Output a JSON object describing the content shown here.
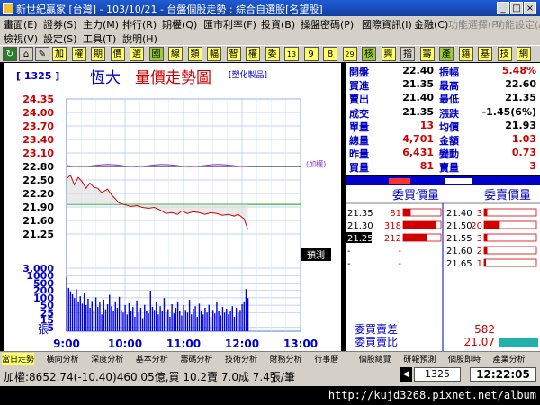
{
  "window": {
    "title": "新世紀贏家 [台灣] - 103/10/21 - 台盤個股走勢 : 綜合自選股[名望股]",
    "controls": [
      "_",
      "□",
      "×"
    ]
  },
  "menu1": [
    {
      "label": "畫面(E)",
      "enabled": true
    },
    {
      "label": "證券(S)",
      "enabled": true
    },
    {
      "label": "主力(M)",
      "enabled": true
    },
    {
      "label": "排行(R)",
      "enabled": true
    },
    {
      "label": "期權(Q)",
      "enabled": true
    },
    {
      "label": "匯市利率(F)",
      "enabled": true
    },
    {
      "label": "投資(B)",
      "enabled": true
    },
    {
      "label": "操盤密碼(P)",
      "enabled": true
    },
    {
      "label": "國際資訊(I)",
      "enabled": true
    },
    {
      "label": "金融(C)",
      "enabled": true
    },
    {
      "label": "功能選擇(P)",
      "enabled": false
    },
    {
      "label": "功能設定(A)",
      "enabled": false
    }
  ],
  "menu2": [
    {
      "label": "檢視(V)",
      "enabled": true
    },
    {
      "label": "設定(S)",
      "enabled": true
    },
    {
      "label": "工具(T)",
      "enabled": true
    },
    {
      "label": "說明(H)",
      "enabled": true
    }
  ],
  "toolbar": [
    "加",
    "權",
    "期",
    "價",
    "選",
    "國",
    "線",
    "類",
    "幅",
    "智",
    "權",
    "委",
    "13",
    "9",
    "8",
    "29",
    "核",
    "興",
    "指",
    "籌",
    "產",
    "籍",
    "基",
    "技",
    "網"
  ],
  "chart": {
    "code": "[ 1325 ]",
    "name": "恆大",
    "heading": "量價走勢圖",
    "industry": "[塑化製品]",
    "ref_label": "(加權)",
    "panel_label": "預測",
    "vol_unit": "張",
    "price_ticks": [
      "24.35",
      "24.00",
      "23.70",
      "23.40",
      "23.10",
      "22.80",
      "22.50",
      "22.20",
      "21.90",
      "21.60",
      "21.25"
    ],
    "vol_ticks": [
      "3,000",
      "1000",
      "500",
      "200",
      "100",
      "50",
      "25",
      "15",
      "5"
    ],
    "time_ticks": [
      "9:00",
      "10:00",
      "11:00",
      "12:00",
      "13:00"
    ]
  },
  "quote": {
    "rows": [
      {
        "l1": "開盤",
        "v1": "22.40",
        "c1": "#000000",
        "l2": "振幅",
        "v2": "5.48%",
        "c2": "#d00000"
      },
      {
        "l1": "買進",
        "v1": "21.35",
        "c1": "#000000",
        "l2": "最高",
        "v2": "22.60",
        "c2": "#000000"
      },
      {
        "l1": "賣出",
        "v1": "21.40",
        "c1": "#000000",
        "l2": "最低",
        "v2": "21.35",
        "c2": "#000000"
      },
      {
        "l1": "成交",
        "v1": "21.35",
        "c1": "#000000",
        "l2": "漲跌",
        "v2": "-1.45(6%)",
        "c2": "#000000"
      },
      {
        "l1": "單量",
        "v1": "13",
        "c1": "#d00000",
        "l2": "均價",
        "v2": "21.93",
        "c2": "#000000"
      },
      {
        "l1": "總量",
        "v1": "4,701",
        "c1": "#d00000",
        "l2": "金額",
        "v2": "1.03",
        "c2": "#d00000"
      },
      {
        "l1": "昨量",
        "v1": "6,431",
        "c1": "#d00000",
        "l2": "變動",
        "v2": "0.73",
        "c2": "#d00000"
      },
      {
        "l1": "買量",
        "v1": "81",
        "c1": "#d00000",
        "l2": "賣量",
        "v2": "3",
        "c2": "#d00000"
      }
    ]
  },
  "orders": {
    "bid_header": "委買價量",
    "ask_header": "委賣價量",
    "bids": [
      {
        "price": "21.35",
        "qty": "81",
        "fill": 0.2
      },
      {
        "price": "21.30",
        "qty": "318",
        "fill": 0.88
      },
      {
        "price": "21.25",
        "qty": "212",
        "fill": 0.62
      },
      {
        "price": "-",
        "qty": "-",
        "fill": 0
      },
      {
        "price": "-",
        "qty": "-",
        "fill": 0
      }
    ],
    "asks": [
      {
        "price": "21.40",
        "qty": "3",
        "fill": 0.02
      },
      {
        "price": "21.50",
        "qty": "20",
        "fill": 0.1
      },
      {
        "price": "21.55",
        "qty": "3",
        "fill": 0.02
      },
      {
        "price": "21.60",
        "qty": "2",
        "fill": 0.02
      },
      {
        "price": "21.65",
        "qty": "1",
        "fill": 0.01
      }
    ],
    "diff_label": "委買賣差",
    "diff_value": "582",
    "ratio_label": "委買賣比",
    "ratio_value": "21.07"
  },
  "tape": [
    "當日走勢",
    "橫向分析",
    "深度分析",
    "基本分析",
    "籌碼分析",
    "技術分析",
    "財務分析",
    "行事曆",
    "個股總覽",
    "研報預測",
    "個股即時",
    "產業分析"
  ],
  "status": {
    "index": "加權:8652.74(-10.40)460.05億,買 10.2賣 7.0成 7.4張/筆",
    "code_box": "1325",
    "clock": "12:22:05"
  },
  "url": "http://kujd3268.pixnet.net/album",
  "series": {
    "price": [
      [
        0,
        22.52
      ],
      [
        4,
        22.6
      ],
      [
        8,
        22.38
      ],
      [
        12,
        22.55
      ],
      [
        16,
        22.45
      ],
      [
        20,
        22.3
      ],
      [
        24,
        22.42
      ],
      [
        28,
        22.32
      ],
      [
        32,
        22.3
      ],
      [
        36,
        22.2
      ],
      [
        42,
        22.28
      ],
      [
        46,
        22.15
      ],
      [
        50,
        22.06
      ],
      [
        54,
        21.96
      ],
      [
        60,
        21.92
      ],
      [
        66,
        21.88
      ],
      [
        72,
        21.9
      ],
      [
        78,
        21.86
      ],
      [
        84,
        21.84
      ],
      [
        90,
        21.86
      ],
      [
        96,
        21.8
      ],
      [
        102,
        21.72
      ],
      [
        108,
        21.74
      ],
      [
        114,
        21.7
      ],
      [
        118,
        21.78
      ],
      [
        124,
        21.72
      ],
      [
        130,
        21.76
      ],
      [
        136,
        21.74
      ],
      [
        142,
        21.7
      ],
      [
        148,
        21.74
      ],
      [
        154,
        21.72
      ],
      [
        160,
        21.68
      ],
      [
        166,
        21.7
      ],
      [
        172,
        21.66
      ],
      [
        176,
        21.7
      ],
      [
        182,
        21.6
      ],
      [
        186,
        21.35
      ]
    ],
    "avg": [
      [
        0,
        22.55
      ],
      [
        40,
        22.3
      ],
      [
        80,
        22.08
      ],
      [
        120,
        21.98
      ],
      [
        160,
        21.95
      ],
      [
        186,
        21.93
      ]
    ],
    "vol": [
      [
        0,
        800
      ],
      [
        2,
        210
      ],
      [
        4,
        140
      ],
      [
        6,
        95
      ],
      [
        8,
        60
      ],
      [
        10,
        180
      ],
      [
        12,
        40
      ],
      [
        14,
        75
      ],
      [
        16,
        30
      ],
      [
        18,
        110
      ],
      [
        20,
        25
      ],
      [
        22,
        55
      ],
      [
        24,
        18
      ],
      [
        26,
        42
      ],
      [
        28,
        12
      ],
      [
        30,
        65
      ],
      [
        32,
        20
      ],
      [
        34,
        35
      ],
      [
        36,
        8
      ],
      [
        38,
        50
      ],
      [
        40,
        15
      ],
      [
        42,
        28
      ],
      [
        44,
        90
      ],
      [
        46,
        22
      ],
      [
        48,
        12
      ],
      [
        50,
        40
      ],
      [
        52,
        18
      ],
      [
        54,
        70
      ],
      [
        56,
        14
      ],
      [
        58,
        10
      ],
      [
        60,
        25
      ],
      [
        62,
        8
      ],
      [
        64,
        32
      ],
      [
        66,
        12
      ],
      [
        68,
        20
      ],
      [
        70,
        6
      ],
      [
        72,
        45
      ],
      [
        74,
        10
      ],
      [
        76,
        18
      ],
      [
        78,
        5
      ],
      [
        80,
        26
      ],
      [
        82,
        12
      ],
      [
        84,
        9
      ],
      [
        86,
        150
      ],
      [
        88,
        20
      ],
      [
        90,
        14
      ],
      [
        92,
        35
      ],
      [
        94,
        8
      ],
      [
        96,
        22
      ],
      [
        98,
        12
      ],
      [
        100,
        60
      ],
      [
        102,
        10
      ],
      [
        104,
        15
      ],
      [
        106,
        6
      ],
      [
        108,
        28
      ],
      [
        110,
        9
      ],
      [
        112,
        18
      ],
      [
        114,
        40
      ],
      [
        116,
        12
      ],
      [
        118,
        7
      ],
      [
        120,
        25
      ],
      [
        122,
        14
      ],
      [
        124,
        10
      ],
      [
        126,
        48
      ],
      [
        128,
        8
      ],
      [
        130,
        16
      ],
      [
        132,
        22
      ],
      [
        134,
        6
      ],
      [
        136,
        30
      ],
      [
        138,
        12
      ],
      [
        140,
        8
      ],
      [
        142,
        18
      ],
      [
        144,
        10
      ],
      [
        146,
        26
      ],
      [
        148,
        6
      ],
      [
        150,
        14
      ],
      [
        152,
        9
      ],
      [
        154,
        35
      ],
      [
        156,
        12
      ],
      [
        158,
        7
      ],
      [
        160,
        20
      ],
      [
        162,
        10
      ],
      [
        164,
        16
      ],
      [
        166,
        8
      ],
      [
        168,
        12
      ],
      [
        170,
        22
      ],
      [
        172,
        6
      ],
      [
        174,
        18
      ],
      [
        176,
        10
      ],
      [
        178,
        14
      ],
      [
        180,
        28
      ],
      [
        182,
        40
      ],
      [
        184,
        180
      ],
      [
        186,
        60
      ]
    ],
    "ref_price": 22.8,
    "ref2_price": 21.93,
    "price_max": 24.35,
    "price_min": 21.25
  },
  "colors": {
    "up": "#d00000",
    "down": "#000000",
    "blue_label": "#0000c8",
    "volume": "#0000e0",
    "index_line": "#8a2be2",
    "avg_line": "#00a000"
  }
}
